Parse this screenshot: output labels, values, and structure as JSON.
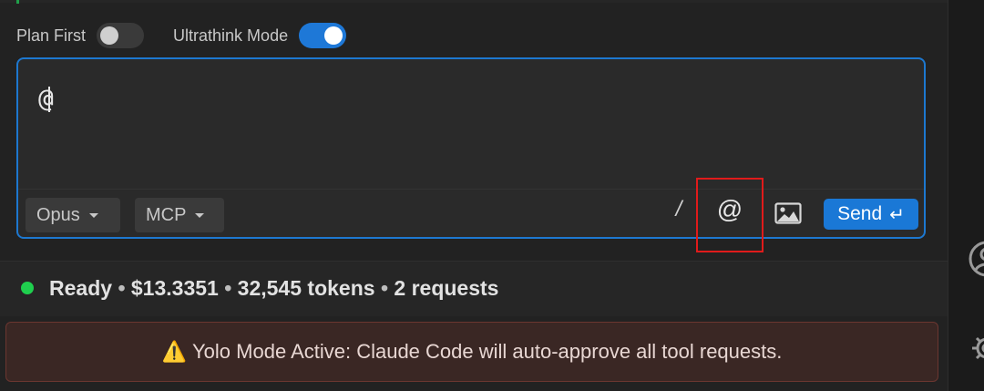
{
  "toggles": [
    {
      "label": "Plan First",
      "state": "off"
    },
    {
      "label": "Ultrathink Mode",
      "state": "on"
    }
  ],
  "input": {
    "value": "@"
  },
  "footer": {
    "model_select": "Opus",
    "mcp_select": "MCP",
    "slash_label": "/",
    "at_label": "@",
    "image_icon": "image-icon",
    "send_label": "Send",
    "send_icon": "↵"
  },
  "status": {
    "state": "Ready",
    "cost": "$13.3351",
    "tokens": "32,545 tokens",
    "requests": "2 requests",
    "separator": "•"
  },
  "warning": {
    "icon": "⚠️",
    "text": "Yolo Mode Active: Claude Code will auto-approve all tool requests."
  },
  "colors": {
    "accent": "#1e78d7",
    "status_ok": "#1fcf4e",
    "warning_bg": "#3a2724",
    "highlight": "#e01b1b"
  }
}
